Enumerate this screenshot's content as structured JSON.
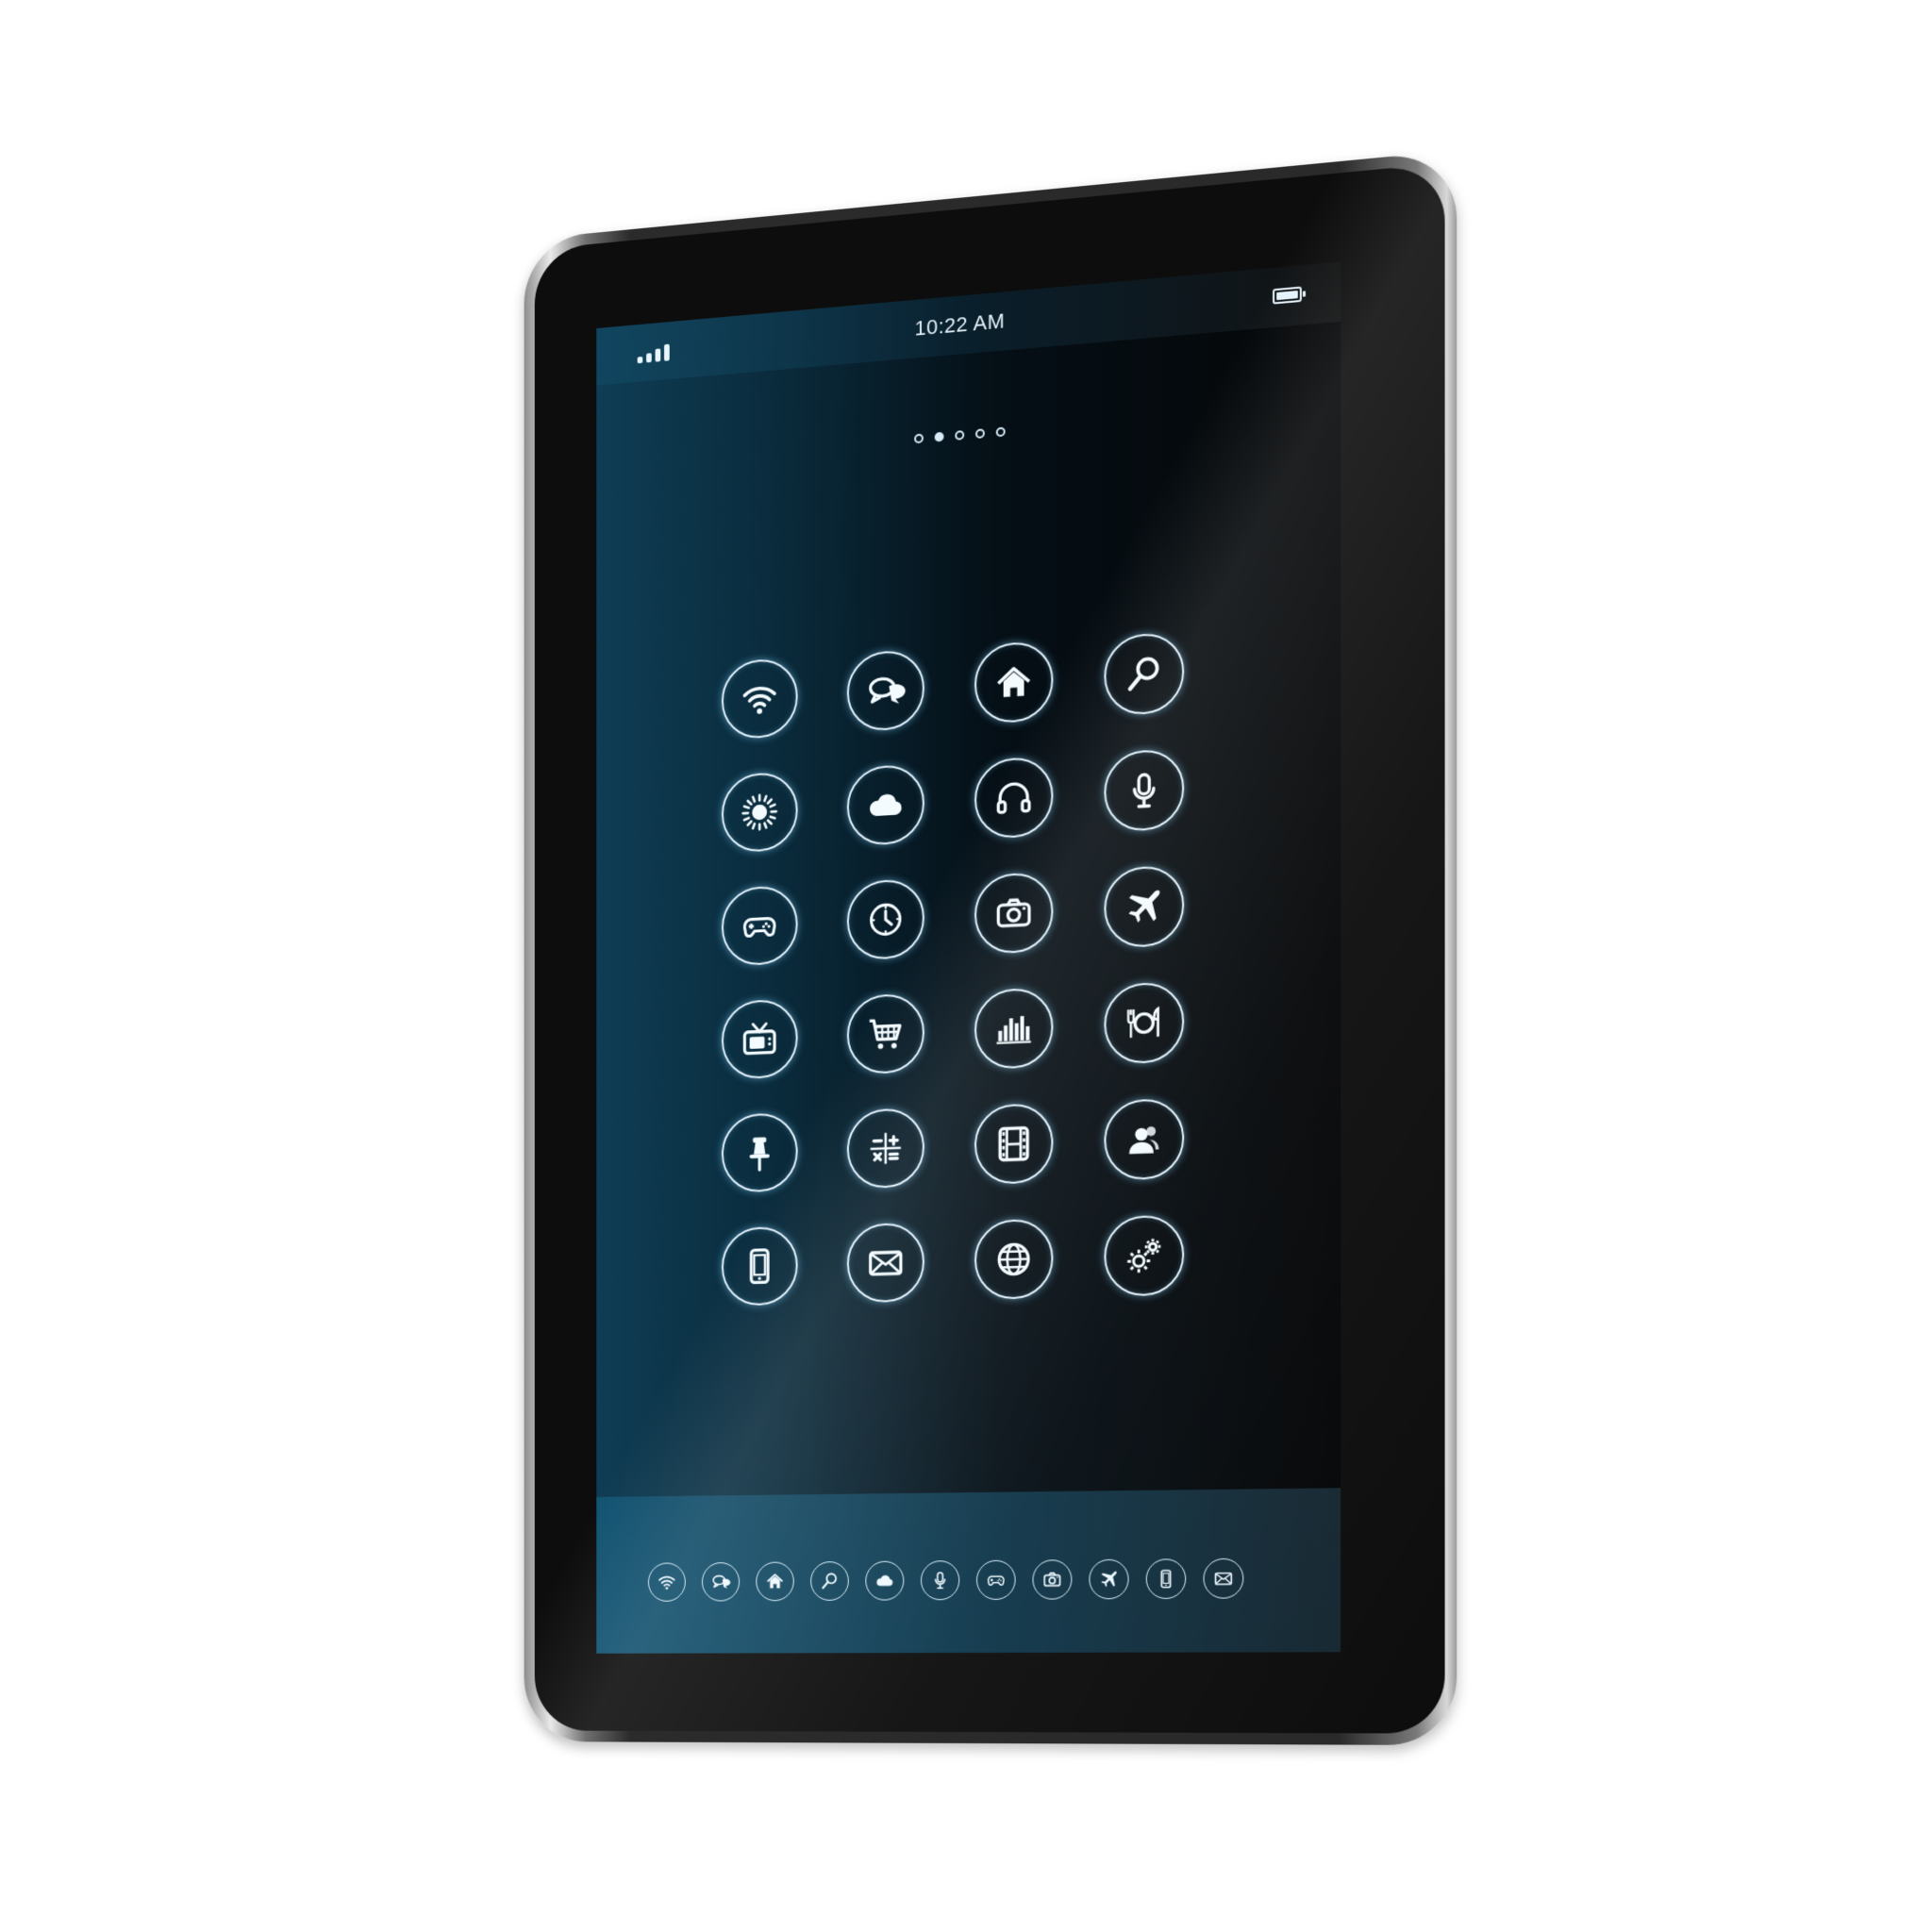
{
  "status_bar": {
    "time": "10:22 AM",
    "signal_icon": "signal-bars-icon",
    "battery_icon": "battery-icon",
    "battery_level": 1.0
  },
  "pager": {
    "page_count": 5,
    "current_page": 2
  },
  "home_apps": [
    [
      "wifi-icon",
      "chat-icon",
      "home-icon",
      "search-icon"
    ],
    [
      "sun-icon",
      "cloud-icon",
      "headphones-icon",
      "microphone-icon"
    ],
    [
      "gamepad-icon",
      "clock-icon",
      "camera-icon",
      "airplane-icon"
    ],
    [
      "tv-icon",
      "cart-icon",
      "bar-chart-icon",
      "dining-icon"
    ],
    [
      "pushpin-icon",
      "calculator-icon",
      "film-icon",
      "contact-icon"
    ],
    [
      "phone-icon",
      "mail-icon",
      "globe-icon",
      "settings-icon"
    ]
  ],
  "dock_apps": [
    "wifi-icon",
    "chat-icon",
    "home-icon",
    "search-icon",
    "cloud-icon",
    "microphone-icon",
    "gamepad-icon",
    "camera-icon",
    "airplane-icon",
    "phone-icon",
    "mail-icon"
  ],
  "colors": {
    "screen_left": "#0f3d55",
    "screen_right": "#050607",
    "icon_stroke": "#e7f6ff",
    "icon_glow": "#82d2ff"
  }
}
